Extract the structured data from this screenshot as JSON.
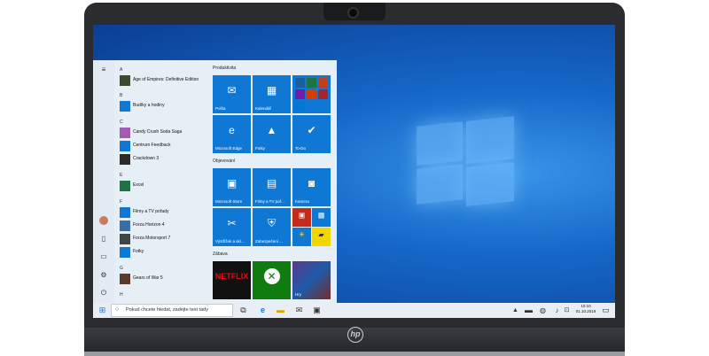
{
  "device": {
    "brand_logo": "hp"
  },
  "start_menu": {
    "letters": [
      "A",
      "B",
      "C",
      "E",
      "F",
      "G",
      "H"
    ],
    "apps": [
      {
        "name": "Age of Empires: Definitive Edition",
        "color": "#3a4a2a"
      },
      {
        "name": "Budíky a hodiny",
        "color": "#0f78d4"
      },
      {
        "name": "Candy Crush Soda Saga",
        "color": "#a35bb0"
      },
      {
        "name": "Centrum Feedback",
        "color": "#0f78d4"
      },
      {
        "name": "Crackdown 3",
        "color": "#2b2b2b"
      },
      {
        "name": "Excel",
        "color": "#1f7244"
      },
      {
        "name": "Filmy a TV pořady",
        "color": "#0f78d4"
      },
      {
        "name": "Forza Horizon 4",
        "color": "#3b6ea5"
      },
      {
        "name": "Forza Motorsport 7",
        "color": "#444444"
      },
      {
        "name": "Fotky",
        "color": "#0f78d4"
      },
      {
        "name": "Gears of War 5",
        "color": "#5a3a2a"
      }
    ],
    "groups": {
      "productivity": "Produktivita",
      "explore": "Objevování",
      "entertainment": "Zábava"
    },
    "tiles": {
      "mail": "Pošta",
      "calendar": "Kalendář",
      "edge": "Microsoft Edge",
      "photos": "Fotky",
      "todo": "To-Do",
      "store": "Microsoft Store",
      "movies": "Filmy a TV poř...",
      "camera": "Kamera",
      "weather": "Výstřižek a skí...",
      "security": "Zabezpečení ...",
      "netflix": "NETFLIX",
      "games": "Hry"
    }
  },
  "taskbar": {
    "search_placeholder": "Pokud chcete hledat, zadejte text tady",
    "time": "10:10",
    "date": "01.10.2019"
  },
  "colors": {
    "tile_blue": "#0f78d4",
    "netflix_red": "#e50914",
    "xbox_green": "#107c10"
  }
}
